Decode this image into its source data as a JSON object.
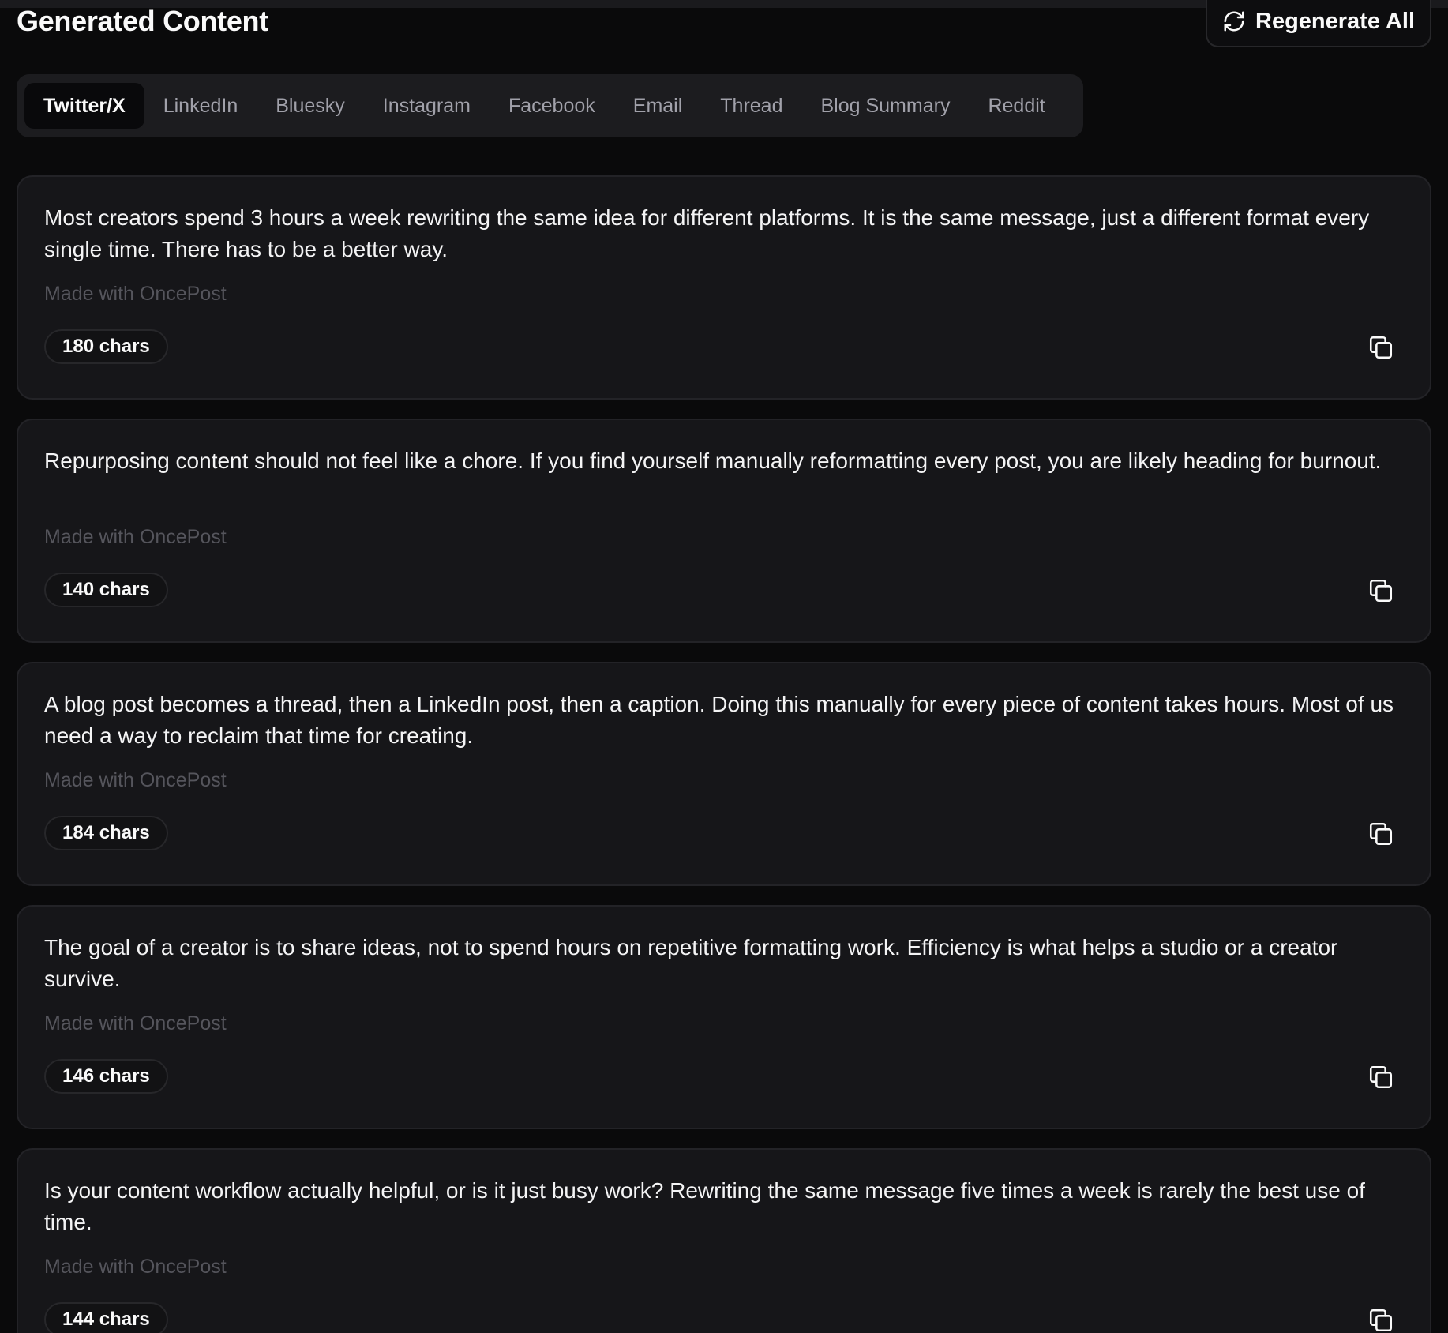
{
  "header": {
    "title": "Generated Content",
    "regenerate_label": "Regenerate All",
    "regenerate_icon": "refresh-icon"
  },
  "tabs": [
    {
      "label": "Twitter/X",
      "active": true
    },
    {
      "label": "LinkedIn",
      "active": false
    },
    {
      "label": "Bluesky",
      "active": false
    },
    {
      "label": "Instagram",
      "active": false
    },
    {
      "label": "Facebook",
      "active": false
    },
    {
      "label": "Email",
      "active": false
    },
    {
      "label": "Thread",
      "active": false
    },
    {
      "label": "Blog Summary",
      "active": false
    },
    {
      "label": "Reddit",
      "active": false
    }
  ],
  "posts": [
    {
      "text": "Most creators spend 3 hours a week rewriting the same idea for different platforms. It is the same message, just a different format every single time. There has to be a better way.",
      "signature": "Made with OncePost",
      "char_count": "180 chars"
    },
    {
      "text": "Repurposing content should not feel like a chore. If you find yourself manually reformatting every post, you are likely heading for burnout.",
      "signature": "Made with OncePost",
      "char_count": "140 chars"
    },
    {
      "text": "A blog post becomes a thread, then a LinkedIn post, then a caption. Doing this manually for every piece of content takes hours. Most of us need a way to reclaim that time for creating.",
      "signature": "Made with OncePost",
      "char_count": "184 chars"
    },
    {
      "text": "The goal of a creator is to share ideas, not to spend hours on repetitive formatting work. Efficiency is what helps a studio or a creator survive.",
      "signature": "Made with OncePost",
      "char_count": "146 chars"
    },
    {
      "text": "Is your content workflow actually helpful, or is it just busy work? Rewriting the same message five times a week is rarely the best use of time.",
      "signature": "Made with OncePost",
      "char_count": "144 chars"
    }
  ],
  "icons": {
    "copy": "copy-icon"
  },
  "colors": {
    "background": "#0a0a0b",
    "card": "#161619",
    "tab_bar": "#1c1c1f",
    "text_primary": "#f4f4f5",
    "text_muted": "#a1a1aa",
    "signature": "#55555c"
  }
}
